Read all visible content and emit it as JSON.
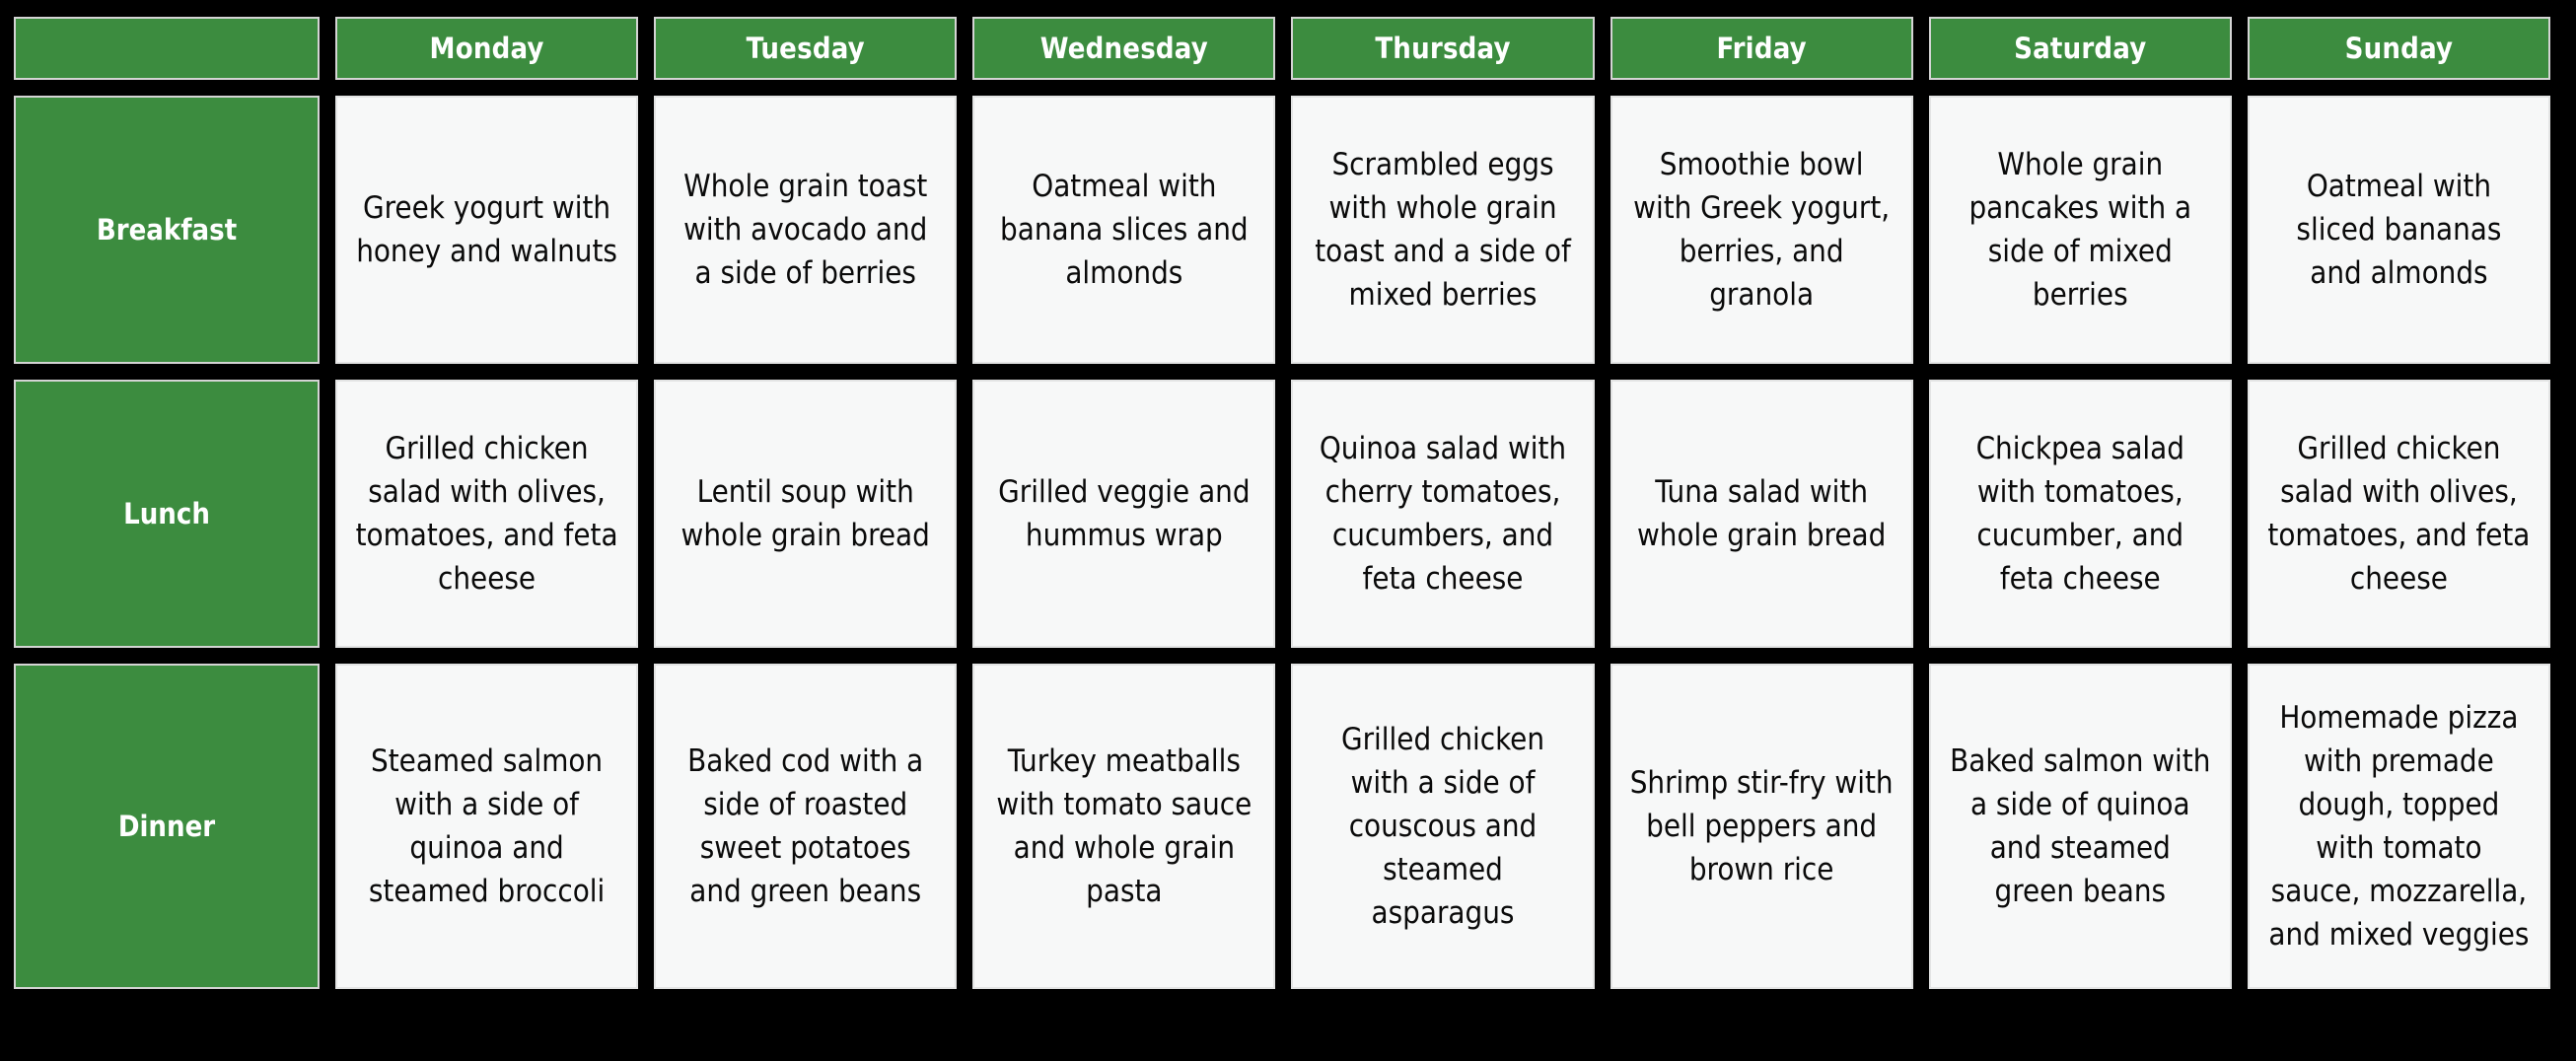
{
  "table": {
    "corner_label": "",
    "column_headers": [
      "Monday",
      "Tuesday",
      "Wednesday",
      "Thursday",
      "Friday",
      "Saturday",
      "Sunday"
    ],
    "row_headers": [
      "Breakfast",
      "Lunch",
      "Dinner"
    ],
    "rows": [
      {
        "label": "Breakfast",
        "cells": [
          "Greek yogurt with honey and walnuts",
          "Whole grain toast with avocado and a side of berries",
          "Oatmeal with banana slices and almonds",
          "Scrambled eggs with whole grain toast and a side of mixed berries",
          "Smoothie bowl with Greek yogurt, berries, and granola",
          "Whole grain pancakes with a side of mixed berries",
          "Oatmeal with sliced bananas and almonds"
        ]
      },
      {
        "label": "Lunch",
        "cells": [
          "Grilled chicken salad with olives, tomatoes, and feta cheese",
          "Lentil soup with whole grain bread",
          "Grilled veggie and hummus wrap",
          "Quinoa salad with cherry tomatoes, cucumbers, and feta cheese",
          "Tuna salad with whole grain bread",
          "Chickpea salad with tomatoes, cucumber, and feta cheese",
          "Grilled chicken salad with olives, tomatoes, and feta cheese"
        ]
      },
      {
        "label": "Dinner",
        "cells": [
          "Steamed salmon with a side of quinoa and steamed broccoli",
          "Baked cod with a side of roasted sweet potatoes and green beans",
          "Turkey meatballs with tomato sauce and whole grain pasta",
          "Grilled chicken with a side of couscous and steamed asparagus",
          "Shrimp stir-fry with bell peppers and brown rice",
          "Baked salmon with a side of quinoa and steamed green beans",
          "Homemade pizza with premade dough, topped with tomato sauce, mozzarella, and mixed veggies"
        ]
      }
    ]
  },
  "colors": {
    "header_green": "#3c8c3f",
    "header_text": "#ffffff",
    "cell_background": "#f7f8f8",
    "cell_text": "#0a0a0a",
    "page_background": "#000000",
    "cell_border": "#d4d4d4"
  }
}
